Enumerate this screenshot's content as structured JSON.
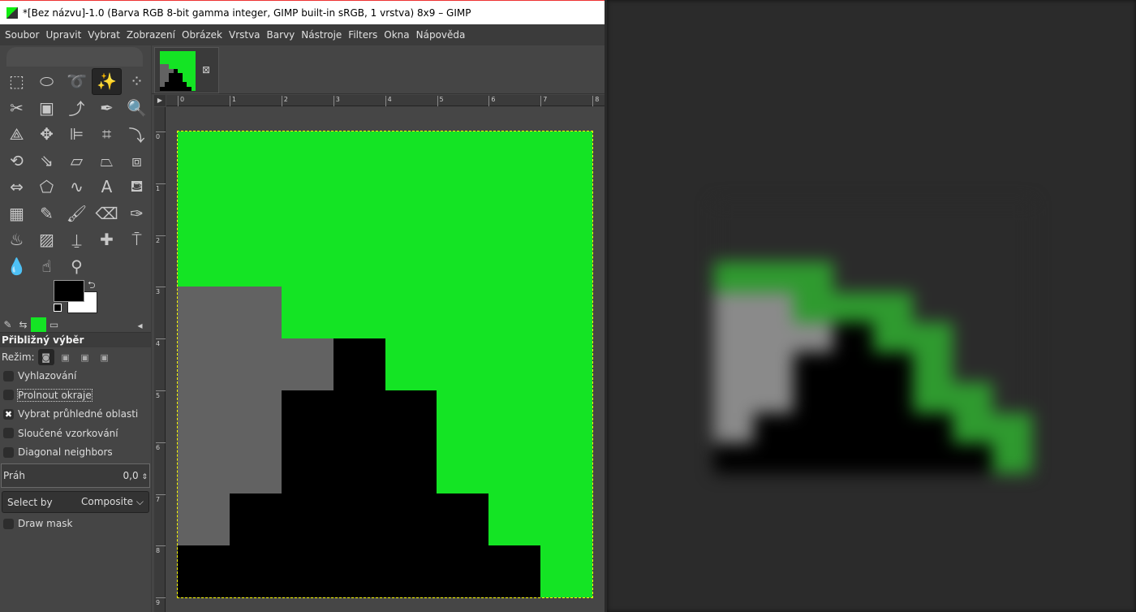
{
  "window": {
    "title": "*[Bez názvu]-1.0 (Barva RGB 8-bit gamma integer, GIMP built-in sRGB, 1 vrstva) 8x9 – GIMP"
  },
  "menu": [
    "Soubor",
    "Upravit",
    "Vybrat",
    "Zobrazení",
    "Obrázek",
    "Vrstva",
    "Barvy",
    "Nástroje",
    "Filters",
    "Okna",
    "Nápověda"
  ],
  "tools": [
    {
      "name": "rect-select",
      "glyph": "⬚"
    },
    {
      "name": "ellipse-select",
      "glyph": "⬭"
    },
    {
      "name": "free-select",
      "glyph": "➰"
    },
    {
      "name": "fuzzy-select",
      "glyph": "✨",
      "active": true
    },
    {
      "name": "color-select",
      "glyph": "⁘"
    },
    {
      "name": "scissors",
      "glyph": "✂"
    },
    {
      "name": "foreground-select",
      "glyph": "▣"
    },
    {
      "name": "paths",
      "glyph": "⤴"
    },
    {
      "name": "color-picker",
      "glyph": "✒"
    },
    {
      "name": "zoom",
      "glyph": "🔍"
    },
    {
      "name": "measure",
      "glyph": "⟁"
    },
    {
      "name": "move",
      "glyph": "✥"
    },
    {
      "name": "align",
      "glyph": "⊫"
    },
    {
      "name": "crop",
      "glyph": "⌗"
    },
    {
      "name": "unified-transform",
      "glyph": "⤵"
    },
    {
      "name": "rotate",
      "glyph": "⟲"
    },
    {
      "name": "scale",
      "glyph": "⇘"
    },
    {
      "name": "shear",
      "glyph": "▱"
    },
    {
      "name": "perspective",
      "glyph": "⏢"
    },
    {
      "name": "3d-transform",
      "glyph": "⧈"
    },
    {
      "name": "flip",
      "glyph": "⇔"
    },
    {
      "name": "cage",
      "glyph": "⬠"
    },
    {
      "name": "warp",
      "glyph": "∿"
    },
    {
      "name": "text",
      "glyph": "A"
    },
    {
      "name": "bucket-fill",
      "glyph": "⛾"
    },
    {
      "name": "gradient",
      "glyph": "▦"
    },
    {
      "name": "pencil",
      "glyph": "✎"
    },
    {
      "name": "paintbrush",
      "glyph": "🖌"
    },
    {
      "name": "eraser",
      "glyph": "⌫"
    },
    {
      "name": "airbrush",
      "glyph": "✑"
    },
    {
      "name": "ink",
      "glyph": "♨"
    },
    {
      "name": "mypaint-brush",
      "glyph": "▨"
    },
    {
      "name": "clone",
      "glyph": "⍊"
    },
    {
      "name": "heal",
      "glyph": "✚"
    },
    {
      "name": "perspective-clone",
      "glyph": "⍑"
    },
    {
      "name": "blur",
      "glyph": "💧"
    },
    {
      "name": "smudge",
      "glyph": "☝"
    },
    {
      "name": "dodge-burn",
      "glyph": "⚲"
    }
  ],
  "colors": {
    "foreground": "#000000",
    "background": "#ffffff",
    "green": "#14e424",
    "gray": "#626262",
    "black": "#000000"
  },
  "tool_options": {
    "title": "Přibližný výběr",
    "mode_label": "Režim:",
    "checkboxes": [
      {
        "label": "Vyhlazování",
        "checked": false
      },
      {
        "label": "Prolnout okraje",
        "checked": false
      },
      {
        "label": "Vybrat průhledné oblasti",
        "checked": true
      },
      {
        "label": "Sloučené vzorkování",
        "checked": false
      },
      {
        "label": "Diagonal neighbors",
        "checked": false
      }
    ],
    "threshold_label": "Práh",
    "threshold_value": "0,0",
    "select_by_label": "Select by",
    "select_by_value": "Composite",
    "draw_mask_label": "Draw mask"
  },
  "rulers": {
    "h": [
      "0",
      "1",
      "2",
      "3",
      "4",
      "5",
      "6",
      "7",
      "8"
    ],
    "v": [
      "0",
      "1",
      "2",
      "3",
      "4",
      "5",
      "6",
      "7",
      "8",
      "9"
    ]
  },
  "image_pixels": [
    "GGGGGGGG",
    "GGGGGGGG",
    "GGGGGGGG",
    "YYGGGGGG",
    "YYYKGGGG",
    "YYKKKGGG",
    "YYKKKGGG",
    "YKKKKKGG",
    "KKKKKKKG"
  ]
}
